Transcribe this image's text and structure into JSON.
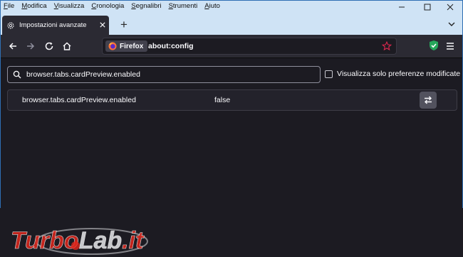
{
  "menu": [
    "File",
    "Modifica",
    "Visualizza",
    "Cronologia",
    "Segnalibri",
    "Strumenti",
    "Aiuto"
  ],
  "tab": {
    "title": "Impostazioni avanzate"
  },
  "urlbar": {
    "identity_label": "Firefox",
    "url": "about:config"
  },
  "search": {
    "value": "browser.tabs.cardPreview.enabled"
  },
  "modified_filter": {
    "label": "Visualizza solo preferenze modificate",
    "checked": false
  },
  "preferences": [
    {
      "name": "browser.tabs.cardPreview.enabled",
      "value": "false"
    }
  ],
  "watermark": {
    "text": "TurboLab.it"
  },
  "colors": {
    "accent": "#0060df",
    "toolbar": "#2b2a33",
    "content_bg": "#1c1b22",
    "chrome_bg": "#cfe3f5",
    "urlbar_text": "#fbfbfe",
    "watermark_red": "#e0261c"
  },
  "icons": [
    "gear-icon",
    "close-icon",
    "plus-icon",
    "tabs-list-icon",
    "back-icon",
    "forward-icon",
    "reload-icon",
    "home-icon",
    "firefox-logo-icon",
    "star-icon",
    "shield-extension-icon",
    "menu-icon",
    "search-icon",
    "toggle-icon"
  ]
}
